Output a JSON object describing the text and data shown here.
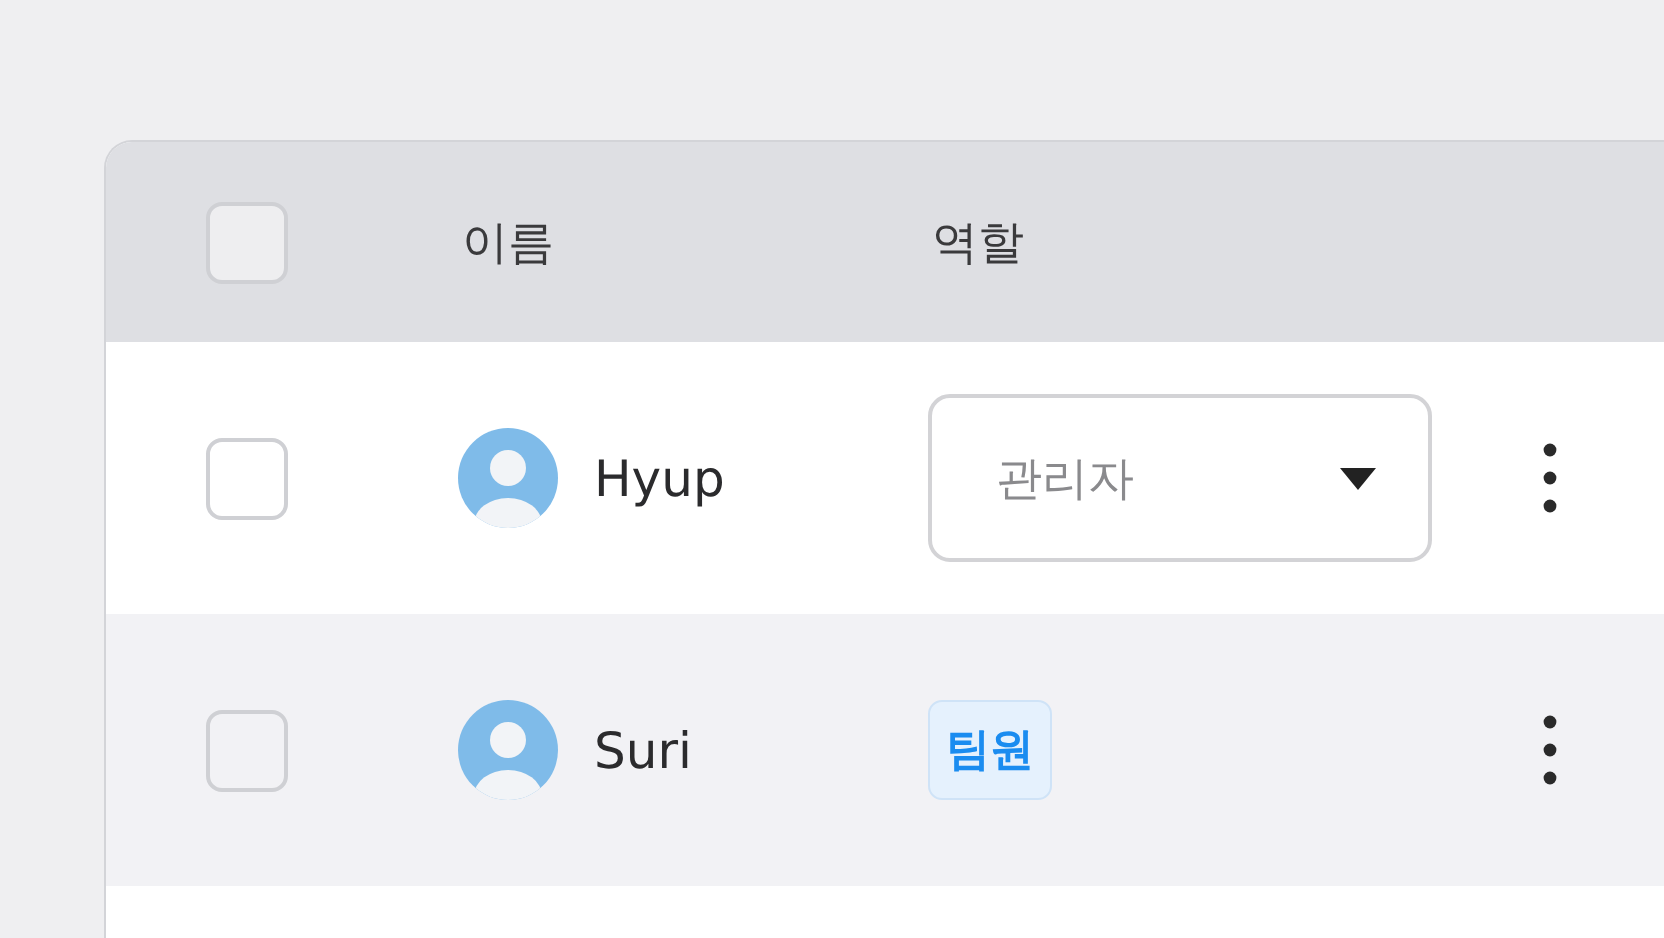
{
  "table": {
    "header_checkbox": {
      "checked": false
    },
    "columns": [
      "이름",
      "역할"
    ],
    "rows": [
      {
        "name": "Hyup",
        "checked": false,
        "highlighted": false,
        "role": {
          "kind": "dropdown",
          "text": "관리자"
        }
      },
      {
        "name": "Suri",
        "checked": false,
        "highlighted": true,
        "role": {
          "kind": "badge",
          "text": "팀원"
        }
      }
    ]
  }
}
